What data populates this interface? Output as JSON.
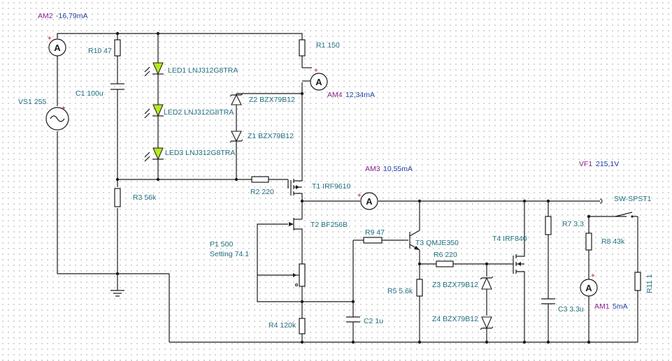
{
  "meters": {
    "am2": {
      "name": "AM2",
      "value": "-16,79mA"
    },
    "am4": {
      "name": "AM4",
      "value": "12,34mA"
    },
    "am3": {
      "name": "AM3",
      "value": "10,55mA"
    },
    "am1": {
      "name": "AM1",
      "value": "5mA"
    },
    "vf1": {
      "name": "VF1",
      "value": "215,1V"
    }
  },
  "components": {
    "r10": "R10 47",
    "c1": "C1 100u",
    "vs1": "VS1 255",
    "led1": "LED1 LNJ312G8TRA",
    "led2": "LED2 LNJ312G8TRA",
    "led3": "LED3 LNJ312G8TRA",
    "r1": "R1 150",
    "z2": "Z2 BZX79B12",
    "z1": "Z1 BZX79B12",
    "r2": "R2 220",
    "t1": "T1 IRF9610",
    "r3": "R3 56k",
    "t2": "T2 BF256B",
    "p1": "P1 500",
    "p1_setting": "Setting 74.1",
    "r9": "R9 47",
    "t3": "T3 QMJE350",
    "r6": "R6 220",
    "t4": "T4 IRF840",
    "r5": "R5 5.6k",
    "z3": "Z3 BZX79B12",
    "z4": "Z4 BZX79B12",
    "r4": "R4 120k",
    "c2": "C2 1u",
    "r7": "R7 3.3",
    "r8": "R8 43k",
    "r11": "R11 1",
    "c3": "C3 3.3u",
    "sw": "SW-SPST1"
  },
  "symbols": {
    "ammeter_glyph": "A",
    "plus_sign": "+"
  }
}
